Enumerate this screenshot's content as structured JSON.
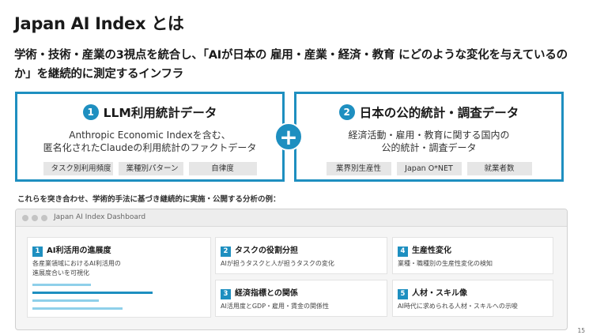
{
  "title": "Japan AI Index とは",
  "lead": "学術・技術・産業の3視点を統合し、「AIが日本の 雇用・産業・経済・教育 にどのような変化を与えているのか」を継続的に測定するインフラ",
  "box1": {
    "num": "1",
    "heading": "LLM利用統計データ",
    "desc_line1": "Anthropic Economic Indexを含む、",
    "desc_line2": "匿名化されたClaudeの利用統計のファクトデータ",
    "tags": [
      "タスク別利用頻度",
      "業種別パターン",
      "自律度"
    ]
  },
  "box2": {
    "num": "2",
    "heading": "日本の公的統計・調査データ",
    "desc_line1": "経済活動・雇用・教育に関する国内の",
    "desc_line2": "公的統計・調査データ",
    "tags": [
      "業界別生産性",
      "Japan O*NET",
      "就業者数"
    ]
  },
  "plus": "+",
  "subcaption": "これらを突き合わせ、学術的手法に基づき継続的に実施・公開する分析の例：",
  "dashboard": {
    "title": "Japan AI Index  Dashboard",
    "cards": [
      {
        "num": "1",
        "title": "AI利活用の進展度",
        "desc_line1": "各産業領域におけるAI利活用の",
        "desc_line2": "進展度合いを可視化"
      },
      {
        "num": "2",
        "title": "タスクの役割分担",
        "desc_line1": "AIが担うタスクと人が担うタスクの変化",
        "desc_line2": ""
      },
      {
        "num": "3",
        "title": "経済指標との関係",
        "desc_line1": "AI活用度とGDP・雇用・賃金の関係性",
        "desc_line2": ""
      },
      {
        "num": "4",
        "title": "生産性変化",
        "desc_line1": "業種・職種別の生産性変化の検知",
        "desc_line2": ""
      },
      {
        "num": "5",
        "title": "人材・スキル像",
        "desc_line1": "AI時代に求められる人材・スキルへの示唆",
        "desc_line2": ""
      }
    ]
  },
  "page_number": "15",
  "colors": {
    "accent": "#1e8fc0",
    "bar_light": "#8fd0ea"
  }
}
